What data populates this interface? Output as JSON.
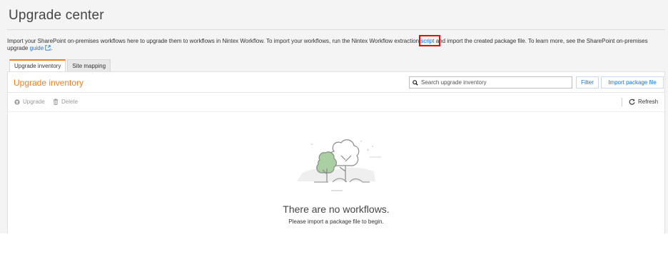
{
  "header": {
    "title": "Upgrade center"
  },
  "description": {
    "text_before": "Import your SharePoint on-premises workflows here to upgrade them to workflows in Nintex Workflow. To import your workflows, run the Nintex Workflow extraction ",
    "script_link": "script",
    "text_middle": " and import the created package file. To learn more, see the SharePoint on-premises upgrade ",
    "guide_link": "guide",
    "text_after": "."
  },
  "tabs": [
    {
      "label": "Upgrade inventory",
      "active": true
    },
    {
      "label": "Site mapping",
      "active": false
    }
  ],
  "panel": {
    "title": "Upgrade inventory",
    "search_placeholder": "Search upgrade inventory",
    "filter_label": "Filter",
    "import_label": "Import package file"
  },
  "toolbar": {
    "upgrade_label": "Upgrade",
    "delete_label": "Delete",
    "refresh_label": "Refresh"
  },
  "empty_state": {
    "title": "There are no workflows.",
    "subtitle": "Please import a package file to begin."
  },
  "colors": {
    "accent": "#f07f1c",
    "link": "#1a73c8",
    "highlight": "#e01010"
  }
}
